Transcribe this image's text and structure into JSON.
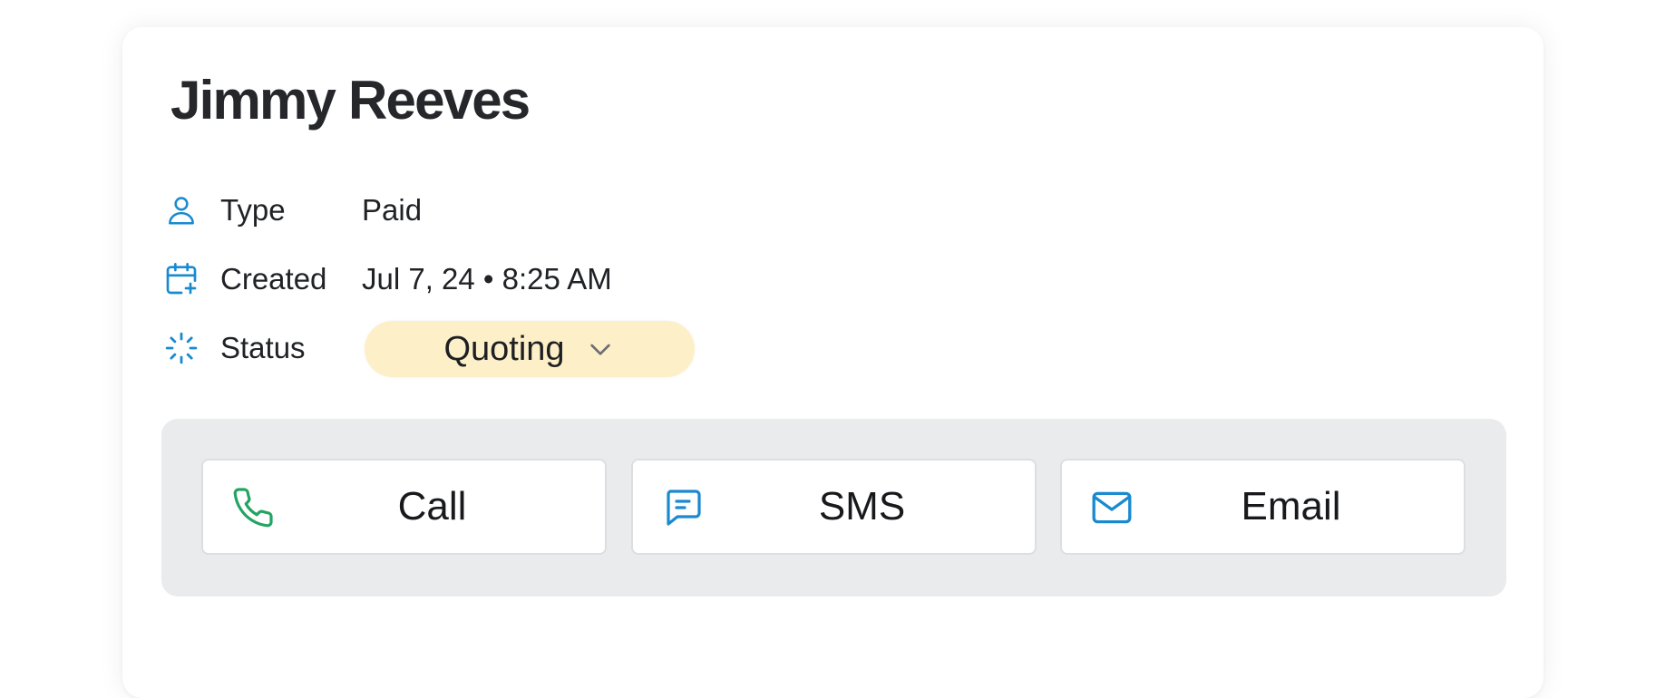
{
  "contact": {
    "name": "Jimmy Reeves"
  },
  "details": {
    "type": {
      "label": "Type",
      "value": "Paid",
      "icon": "person-icon"
    },
    "created": {
      "label": "Created",
      "value": "Jul 7, 24 • 8:25 AM",
      "icon": "calendar-plus-icon"
    },
    "status": {
      "label": "Status",
      "value": "Quoting",
      "icon": "loader-icon"
    }
  },
  "actions": {
    "call": {
      "label": "Call",
      "icon": "phone-icon"
    },
    "sms": {
      "label": "SMS",
      "icon": "message-icon"
    },
    "email": {
      "label": "Email",
      "icon": "mail-icon"
    }
  },
  "colors": {
    "accent": "#1a8ad0",
    "call_green": "#22a462",
    "status_pill": "#fdefc8",
    "actions_bg": "#e9ebed"
  }
}
